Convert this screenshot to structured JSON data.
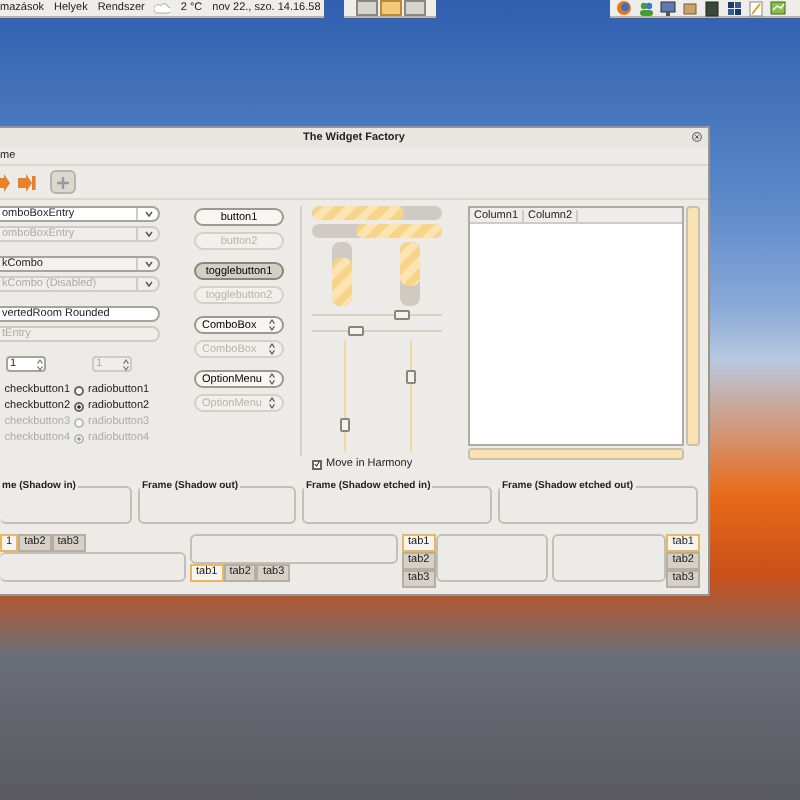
{
  "top_panel": {
    "menus": [
      "mazások",
      "Helyek",
      "Rendszer"
    ],
    "weather": "2 °C",
    "clock": "nov 22., szo. 14.16.58"
  },
  "workspaces": [
    {
      "selected": false
    },
    {
      "selected": true
    },
    {
      "selected": false
    }
  ],
  "window": {
    "title": "The Widget Factory",
    "menu": [
      "me"
    ]
  },
  "entries": [
    {
      "kind": "combo-entry",
      "value": "omboBoxEntry",
      "disabled": false
    },
    {
      "kind": "combo-entry",
      "value": "omboBoxEntry",
      "disabled": true
    },
    {
      "kind": "combo",
      "value": "kCombo",
      "disabled": false
    },
    {
      "kind": "combo",
      "value": "kCombo (Disabled)",
      "disabled": true
    },
    {
      "kind": "entry",
      "value": "vertedRoom Rounded",
      "disabled": false
    },
    {
      "kind": "entry",
      "value": "tEntry",
      "disabled": true
    }
  ],
  "spins": [
    {
      "value": "1",
      "disabled": false
    },
    {
      "value": "1",
      "disabled": true
    }
  ],
  "checks": [
    {
      "label": "checkbutton1",
      "disabled": false
    },
    {
      "label": "checkbutton2",
      "disabled": false
    },
    {
      "label": "checkbutton3",
      "disabled": true
    },
    {
      "label": "checkbutton4",
      "disabled": true
    }
  ],
  "radios": [
    {
      "label": "radiobutton1",
      "selected": false,
      "disabled": false
    },
    {
      "label": "radiobutton2",
      "selected": true,
      "disabled": false
    },
    {
      "label": "radiobutton3",
      "selected": false,
      "disabled": true
    },
    {
      "label": "radiobutton4",
      "selected": true,
      "disabled": true
    }
  ],
  "buttons": [
    {
      "kind": "button",
      "label": "button1",
      "pressed": false,
      "disabled": false
    },
    {
      "kind": "button",
      "label": "button2",
      "pressed": false,
      "disabled": true
    },
    {
      "kind": "toggle",
      "label": "togglebutton1",
      "pressed": true,
      "disabled": false
    },
    {
      "kind": "toggle",
      "label": "togglebutton2",
      "pressed": false,
      "disabled": true
    },
    {
      "kind": "combo",
      "label": "ComboBox",
      "pressed": false,
      "disabled": false
    },
    {
      "kind": "combo",
      "label": "ComboBox",
      "pressed": false,
      "disabled": true
    },
    {
      "kind": "option-menu",
      "label": "OptionMenu",
      "pressed": false,
      "disabled": false
    },
    {
      "kind": "option-menu",
      "label": "OptionMenu",
      "pressed": false,
      "disabled": true
    }
  ],
  "progress_horizontal": [
    {
      "inverted": false,
      "level": 0.7
    },
    {
      "inverted": true,
      "level": 0.66
    }
  ],
  "progress_vertical": [
    {
      "inverted": true,
      "level": 0.75
    },
    {
      "inverted": false,
      "level": 0.7
    }
  ],
  "scales_horizontal": [
    {
      "level": 0.72
    },
    {
      "level": 0.32
    }
  ],
  "scales_vertical": [
    {
      "level": 0.2
    },
    {
      "level": 0.7
    }
  ],
  "harmony": {
    "label": "Move in Harmony",
    "checked": true
  },
  "tree": {
    "columns": [
      "Column1",
      "Column2"
    ]
  },
  "frames": [
    {
      "label": "me (Shadow in)"
    },
    {
      "label": "Frame (Shadow out)"
    },
    {
      "label": "Frame (Shadow etched in)"
    },
    {
      "label": "Frame (Shadow etched out)"
    }
  ],
  "notebooks": [
    {
      "kind": "top",
      "tabs": [
        {
          "label": "1",
          "selected": true
        },
        {
          "label": "tab2",
          "selected": false
        },
        {
          "label": "tab3",
          "selected": false
        }
      ]
    },
    {
      "kind": "bottom",
      "tabs": [
        {
          "label": "tab1",
          "selected": true
        },
        {
          "label": "tab2",
          "selected": false
        },
        {
          "label": "tab3",
          "selected": false
        }
      ]
    },
    {
      "kind": "left",
      "tabs": [
        {
          "label": "tab1",
          "selected": true
        },
        {
          "label": "tab2",
          "selected": false
        },
        {
          "label": "tab3",
          "selected": false
        }
      ]
    },
    {
      "kind": "right",
      "tabs": [
        {
          "label": "tab1",
          "selected": true
        },
        {
          "label": "tab2",
          "selected": false
        },
        {
          "label": "tab3",
          "selected": false
        }
      ]
    }
  ]
}
